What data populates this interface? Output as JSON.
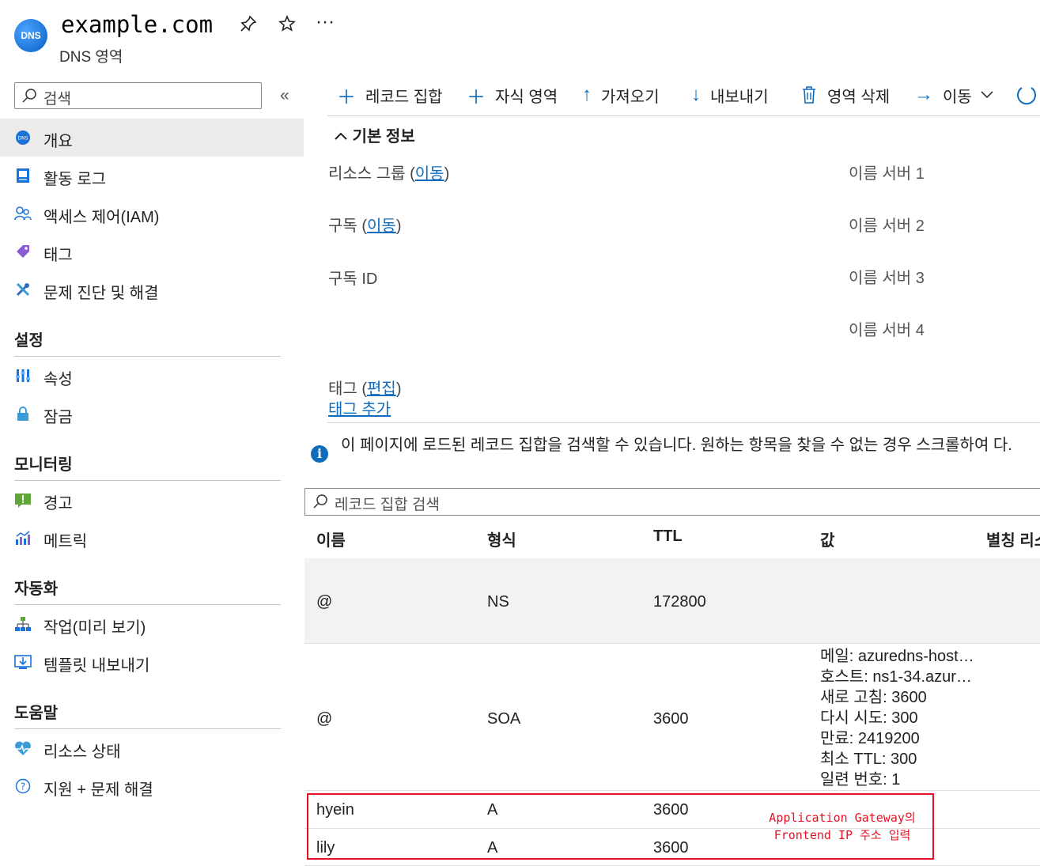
{
  "header": {
    "logo_text": "DNS",
    "title": "example.com",
    "subtitle": "DNS 영역",
    "pin_icon": "pin-icon",
    "star_icon": "star-icon",
    "more_icon": "more-icon"
  },
  "sidebar": {
    "search_placeholder": "검색",
    "collapse": "«",
    "items": [
      {
        "label": "개요",
        "icon": "dns-icon"
      },
      {
        "label": "활동 로그",
        "icon": "activity-log-icon"
      },
      {
        "label": "액세스 제어(IAM)",
        "icon": "people-icon"
      },
      {
        "label": "태그",
        "icon": "tag-icon"
      },
      {
        "label": "문제 진단 및 해결",
        "icon": "wrench-icon"
      }
    ],
    "sections": [
      {
        "title": "설정",
        "items": [
          {
            "label": "속성",
            "icon": "properties-icon"
          },
          {
            "label": "잠금",
            "icon": "lock-icon"
          }
        ]
      },
      {
        "title": "모니터링",
        "items": [
          {
            "label": "경고",
            "icon": "alert-icon"
          },
          {
            "label": "메트릭",
            "icon": "metrics-icon"
          }
        ]
      },
      {
        "title": "자동화",
        "items": [
          {
            "label": "작업(미리 보기)",
            "icon": "tasks-icon"
          },
          {
            "label": "템플릿 내보내기",
            "icon": "export-template-icon"
          }
        ]
      },
      {
        "title": "도움말",
        "items": [
          {
            "label": "리소스 상태",
            "icon": "heart-icon"
          },
          {
            "label": "지원 + 문제 해결",
            "icon": "help-icon"
          }
        ]
      }
    ]
  },
  "toolbar": {
    "record_set": "레코드 집합",
    "child_zone": "자식 영역",
    "import": "가져오기",
    "export": "내보내기",
    "delete_zone": "영역 삭제",
    "move": "이동"
  },
  "essentials": {
    "heading": "기본 정보",
    "resource_group_label": "리소스 그룹 (",
    "resource_group_link": "이동",
    "subscription_label": "구독 (",
    "subscription_link": "이동",
    "subscription_id_label": "구독 ID",
    "close_paren": ")",
    "name_servers": [
      "이름 서버 1",
      "이름 서버 2",
      "이름 서버 3",
      "이름 서버 4"
    ],
    "tags_label": "태그 (",
    "tags_edit_link": "편집",
    "add_tag_link": "태그 추가"
  },
  "info": {
    "text": "이 페이지에 로드된 레코드 집합을 검색할 수 있습니다. 원하는 항목을 찾을 수 없는 경우 스크롤하여 다."
  },
  "records": {
    "search_placeholder": "레코드 집합 검색",
    "columns": [
      "이름",
      "형식",
      "TTL",
      "값",
      "별칭 리소"
    ],
    "rows": [
      {
        "name": "@",
        "type": "NS",
        "ttl": "172800"
      },
      {
        "name": "@",
        "type": "SOA",
        "ttl": "3600"
      },
      {
        "name": "hyein",
        "type": "A",
        "ttl": "3600"
      },
      {
        "name": "lily",
        "type": "A",
        "ttl": "3600"
      }
    ],
    "soa_values": [
      "메일: azuredns-host…",
      "호스트: ns1-34.azur…",
      "새로 고침: 3600",
      "다시 시도: 300",
      "만료: 2419200",
      "최소 TTL: 300",
      "일련 번호: 1"
    ]
  },
  "annotation": {
    "line1": "Application Gateway의",
    "line2": "Frontend IP 주소 입력",
    "color": "#e81123"
  },
  "colors": {
    "accent": "#0f6cbd",
    "active_bg": "#edebe9",
    "ns_row_bg": "#f3f2f1"
  }
}
